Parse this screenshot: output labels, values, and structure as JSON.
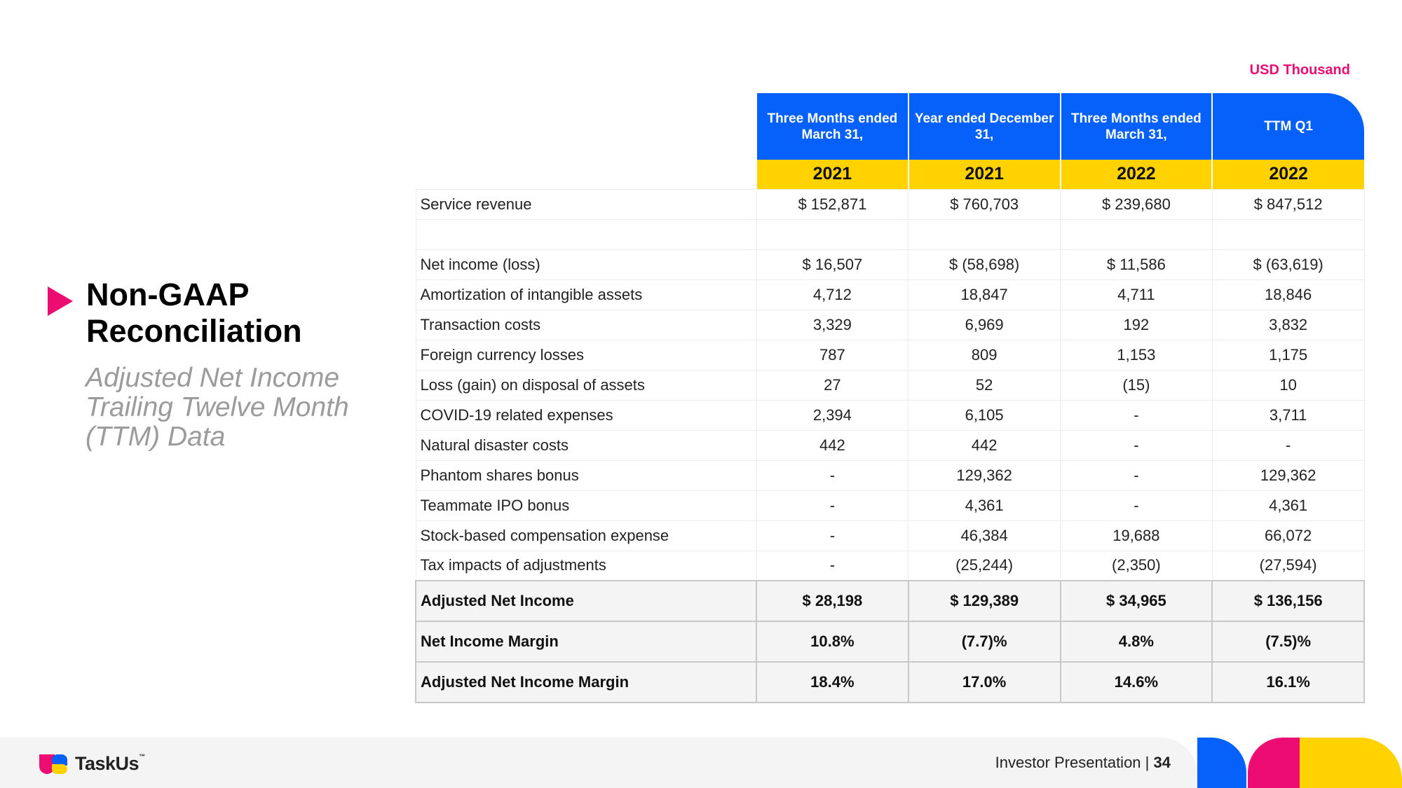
{
  "unit_label": "USD Thousand",
  "side": {
    "title": "Non-GAAP Reconciliation",
    "subtitle": "Adjusted Net Income Trailing Twelve Month (TTM) Data"
  },
  "table": {
    "headers": [
      "Three Months ended March 31,",
      "Year ended December 31,",
      "Three Months ended March 31,",
      "TTM Q1"
    ],
    "years": [
      "2021",
      "2021",
      "2022",
      "2022"
    ],
    "rows": [
      {
        "label": "Service revenue",
        "values": [
          "$ 152,871",
          "$ 760,703",
          "$ 239,680",
          "$ 847,512"
        ]
      },
      {
        "label": "Net income (loss)",
        "values": [
          "$ 16,507",
          "$ (58,698)",
          "$ 11,586",
          "$ (63,619)"
        ]
      },
      {
        "label": "Amortization of intangible assets",
        "values": [
          "4,712",
          "18,847",
          "4,711",
          "18,846"
        ]
      },
      {
        "label": "Transaction costs",
        "values": [
          "3,329",
          "6,969",
          "192",
          "3,832"
        ]
      },
      {
        "label": "Foreign currency losses",
        "values": [
          "787",
          "809",
          "1,153",
          "1,175"
        ]
      },
      {
        "label": "Loss (gain) on disposal of assets",
        "values": [
          "27",
          "52",
          "(15)",
          "10"
        ]
      },
      {
        "label": "COVID-19 related expenses",
        "values": [
          "2,394",
          "6,105",
          "-",
          "3,711"
        ]
      },
      {
        "label": "Natural disaster costs",
        "values": [
          "442",
          "442",
          "-",
          "-"
        ]
      },
      {
        "label": "Phantom shares bonus",
        "values": [
          "-",
          "129,362",
          "-",
          "129,362"
        ]
      },
      {
        "label": "Teammate IPO bonus",
        "values": [
          "-",
          "4,361",
          "-",
          "4,361"
        ]
      },
      {
        "label": "Stock-based compensation expense",
        "values": [
          "-",
          "46,384",
          "19,688",
          "66,072"
        ]
      },
      {
        "label": "Tax impacts of adjustments",
        "values": [
          "-",
          "(25,244)",
          "(2,350)",
          "(27,594)"
        ]
      }
    ],
    "summary_rows": [
      {
        "label": "Adjusted Net Income",
        "values": [
          "$ 28,198",
          "$ 129,389",
          "$ 34,965",
          "$ 136,156"
        ]
      },
      {
        "label": "Net Income Margin",
        "values": [
          "10.8%",
          "(7.7)%",
          "4.8%",
          "(7.5)%"
        ]
      },
      {
        "label": "Adjusted Net Income Margin",
        "values": [
          "18.4%",
          "17.0%",
          "14.6%",
          "16.1%"
        ]
      }
    ]
  },
  "footer": {
    "logo_text": "TaskUs",
    "logo_tm": "™",
    "presentation_label": "Investor Presentation",
    "separator": "|",
    "page_number": "34"
  },
  "colors": {
    "blue": "#0561f9",
    "yellow": "#ffd200",
    "pink": "#ec0c72"
  }
}
